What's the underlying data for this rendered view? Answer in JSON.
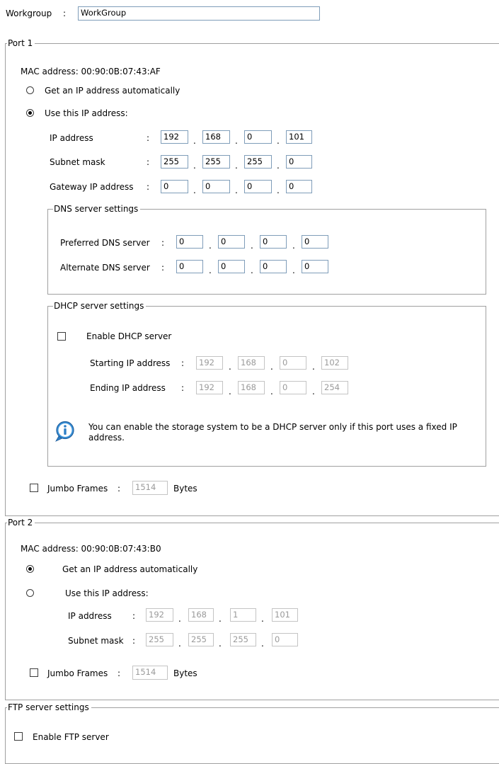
{
  "workgroup": {
    "label": "Workgroup",
    "sep": ":",
    "value": "WorkGroup"
  },
  "port1": {
    "title": "Port 1",
    "mac": "MAC address: 00:90:0B:07:43:AF",
    "auto_label": "Get an IP address automatically",
    "manual_label": "Use this IP address:",
    "ip_label": "IP address",
    "ip": [
      "192",
      "168",
      "0",
      "101"
    ],
    "subnet_label": "Subnet mask",
    "subnet": [
      "255",
      "255",
      "255",
      "0"
    ],
    "gateway_label": "Gateway IP address",
    "gateway": [
      "0",
      "0",
      "0",
      "0"
    ],
    "dns": {
      "title": "DNS server settings",
      "preferred_label": "Preferred DNS server",
      "preferred": [
        "0",
        "0",
        "0",
        "0"
      ],
      "alternate_label": "Alternate DNS server",
      "alternate": [
        "0",
        "0",
        "0",
        "0"
      ]
    },
    "dhcp": {
      "title": "DHCP server settings",
      "enable_label": "Enable DHCP server",
      "start_label": "Starting IP address",
      "start": [
        "192",
        "168",
        "0",
        "102"
      ],
      "end_label": "Ending IP address",
      "end": [
        "192",
        "168",
        "0",
        "254"
      ],
      "info": "You can enable the storage system to be a DHCP server only if this port uses a fixed IP address."
    },
    "jumbo_label": "Jumbo Frames",
    "jumbo_value": "1514",
    "jumbo_unit": "Bytes"
  },
  "port2": {
    "title": "Port 2",
    "mac": "MAC address: 00:90:0B:07:43:B0",
    "auto_label": "Get an IP address automatically",
    "manual_label": "Use this IP address:",
    "ip_label": "IP address",
    "ip": [
      "192",
      "168",
      "1",
      "101"
    ],
    "subnet_label": "Subnet mask",
    "subnet": [
      "255",
      "255",
      "255",
      "0"
    ],
    "jumbo_label": "Jumbo Frames",
    "jumbo_value": "1514",
    "jumbo_unit": "Bytes"
  },
  "ftp": {
    "title": "FTP server settings",
    "enable_label": "Enable FTP server"
  },
  "common": {
    "colon": ":",
    "dot": "."
  }
}
